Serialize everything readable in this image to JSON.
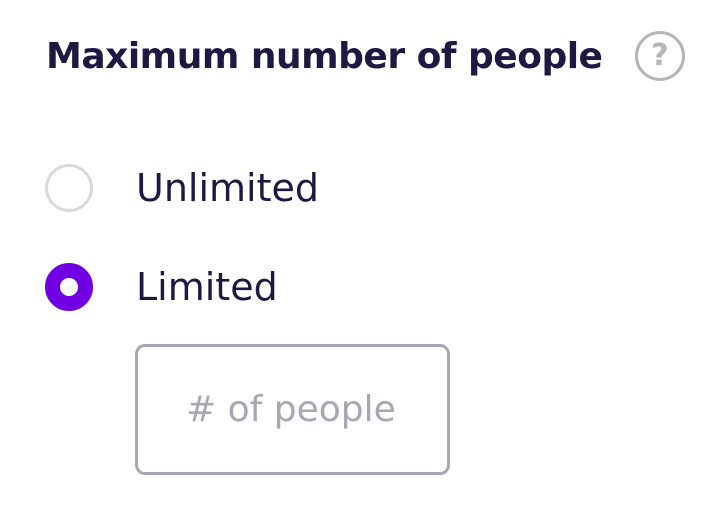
{
  "header": {
    "title": "Maximum number of people",
    "help_icon": "question-mark-icon",
    "help_glyph": "?"
  },
  "options": [
    {
      "label": "Unlimited",
      "selected": false
    },
    {
      "label": "Limited",
      "selected": true
    }
  ],
  "limit_input": {
    "value": "",
    "placeholder": "# of people"
  },
  "colors": {
    "accent": "#7000e3",
    "text": "#1c1a42",
    "muted": "#a8a6b4",
    "radio_border": "#d9d9de"
  }
}
